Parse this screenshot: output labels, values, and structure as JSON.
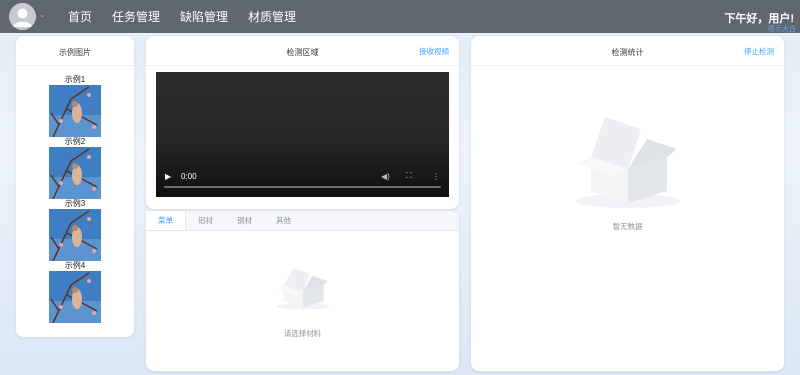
{
  "nav": {
    "items": [
      "首页",
      "任务管理",
      "缺陷管理",
      "材质管理"
    ]
  },
  "header": {
    "greeting": "下午好，用户!",
    "sub": "晤示大白"
  },
  "examples_panel": {
    "title": "示例图片",
    "items": [
      "示例1",
      "示例2",
      "示例3",
      "示例4"
    ]
  },
  "detect_panel": {
    "title": "检测区域",
    "action": "接收视频",
    "video": {
      "time": "0:00"
    }
  },
  "materials_panel": {
    "tabs": [
      "菜单",
      "铝材",
      "钢材",
      "其他"
    ],
    "active_tab": 0,
    "empty_text": "请选择材料"
  },
  "stats_panel": {
    "title": "检测统计",
    "action": "停止检测",
    "empty_text": "暂无数据"
  },
  "colors": {
    "topbar": "#5f6670",
    "accent": "#409eff",
    "muted": "#909399"
  }
}
